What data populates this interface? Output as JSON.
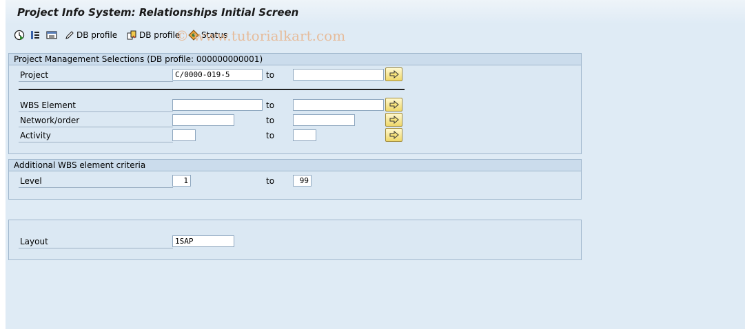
{
  "window": {
    "title": "Project Info System: Relationships Initial Screen"
  },
  "toolbar": {
    "execute_icon": "execute-clock-icon",
    "selection_options_icon": "selection-options-icon",
    "get_variant_icon": "get-variant-icon",
    "db_profile_edit_label": "DB profile",
    "db_profile_copy_label": "DB profile",
    "status_label": "Status"
  },
  "watermark": {
    "text": "© www.tutorialkart.com"
  },
  "project_management": {
    "title": "Project Management Selections (DB profile: 000000000001)",
    "to_label": "to",
    "project": {
      "label": "Project",
      "from": "C/0000-019-5",
      "to": ""
    },
    "wbs_element": {
      "label": "WBS Element",
      "from": "",
      "to": ""
    },
    "network_order": {
      "label": "Network/order",
      "from": "",
      "to": ""
    },
    "activity": {
      "label": "Activity",
      "from": "",
      "to": ""
    }
  },
  "additional_wbs": {
    "title": "Additional WBS element criteria",
    "to_label": "to",
    "level": {
      "label": "Level",
      "from": "1",
      "to": "99"
    }
  },
  "layout_group": {
    "layout": {
      "label": "Layout",
      "value": "1SAP"
    }
  }
}
